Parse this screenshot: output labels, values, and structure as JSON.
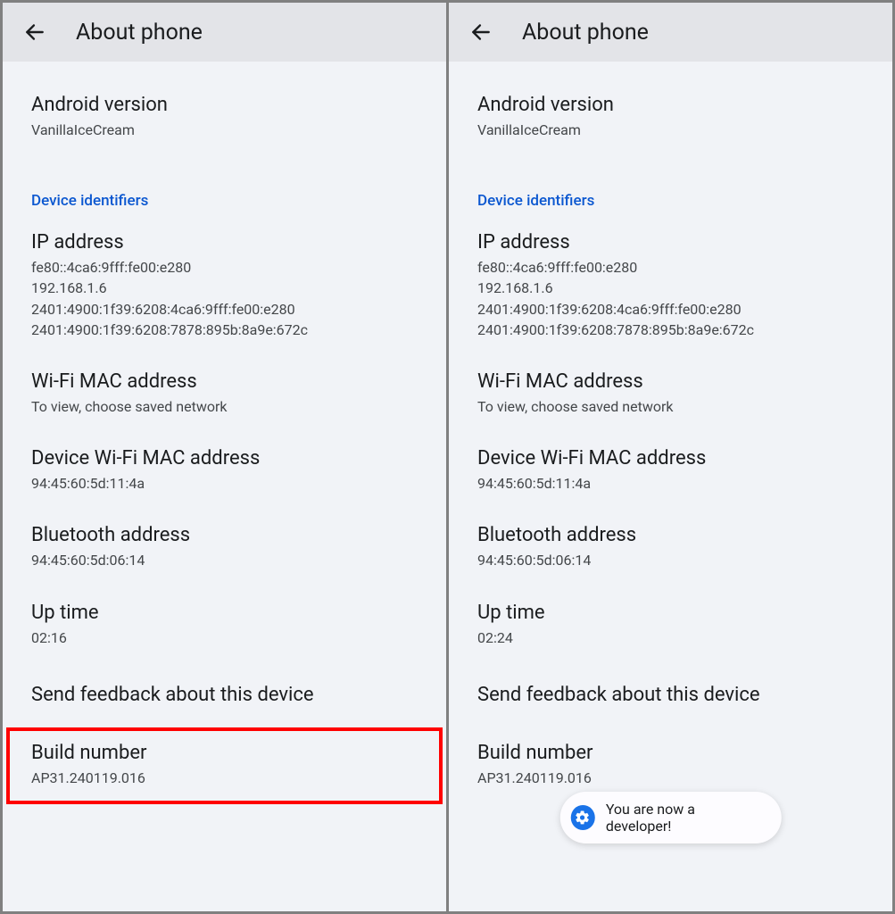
{
  "header": {
    "title": "About phone"
  },
  "left": {
    "android_version": {
      "title": "Android version",
      "value": "VanillaIceCream"
    },
    "device_identifiers_label": "Device identifiers",
    "ip_address": {
      "title": "IP address",
      "value": "fe80::4ca6:9fff:fe00:e280\n192.168.1.6\n2401:4900:1f39:6208:4ca6:9fff:fe00:e280\n2401:4900:1f39:6208:7878:895b:8a9e:672c"
    },
    "wifi_mac": {
      "title": "Wi-Fi MAC address",
      "value": "To view, choose saved network"
    },
    "device_wifi_mac": {
      "title": "Device Wi-Fi MAC address",
      "value": "94:45:60:5d:11:4a"
    },
    "bluetooth": {
      "title": "Bluetooth address",
      "value": "94:45:60:5d:06:14"
    },
    "uptime": {
      "title": "Up time",
      "value": "02:16"
    },
    "feedback": {
      "title": "Send feedback about this device"
    },
    "build": {
      "title": "Build number",
      "value": "AP31.240119.016"
    }
  },
  "right": {
    "android_version": {
      "title": "Android version",
      "value": "VanillaIceCream"
    },
    "device_identifiers_label": "Device identifiers",
    "ip_address": {
      "title": "IP address",
      "value": "fe80::4ca6:9fff:fe00:e280\n192.168.1.6\n2401:4900:1f39:6208:4ca6:9fff:fe00:e280\n2401:4900:1f39:6208:7878:895b:8a9e:672c"
    },
    "wifi_mac": {
      "title": "Wi-Fi MAC address",
      "value": "To view, choose saved network"
    },
    "device_wifi_mac": {
      "title": "Device Wi-Fi MAC address",
      "value": "94:45:60:5d:11:4a"
    },
    "bluetooth": {
      "title": "Bluetooth address",
      "value": "94:45:60:5d:06:14"
    },
    "uptime": {
      "title": "Up time",
      "value": "02:24"
    },
    "feedback": {
      "title": "Send feedback about this device"
    },
    "build": {
      "title": "Build number",
      "value": "AP31.240119.016"
    },
    "toast": "You are now a developer!"
  }
}
